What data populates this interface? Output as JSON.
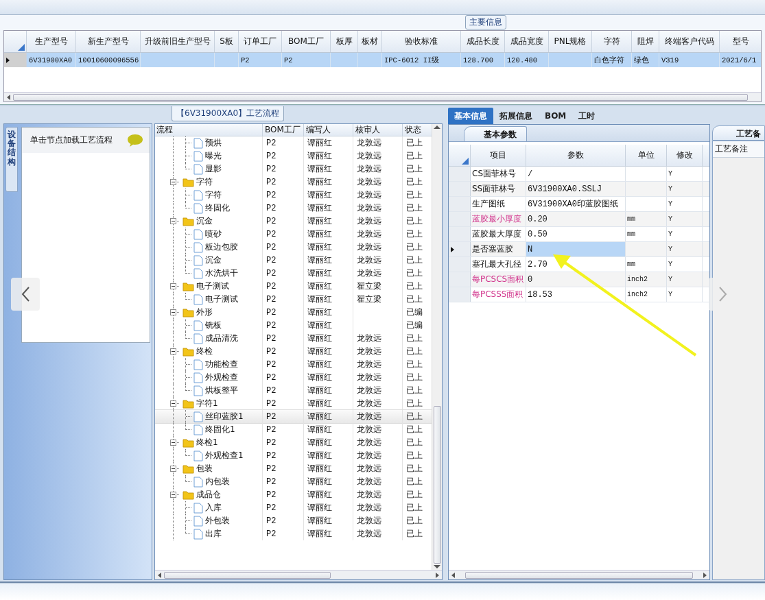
{
  "main_info": {
    "title": "主要信息",
    "columns": [
      "生产型号",
      "新生产型号",
      "升级前旧生产型号",
      "S板",
      "订单工厂",
      "BOM工厂",
      "板厚",
      "板材",
      "验收标准",
      "成品长度",
      "成品宽度",
      "PNL规格",
      "字符",
      "阻焊",
      "终端客户代码",
      "型号"
    ],
    "rows": [
      {
        "selected": true,
        "cells": [
          "6V31900XA0",
          "10010600096556",
          null,
          null,
          "P2",
          "P2",
          null,
          null,
          "IPC-6012 II级",
          "128.700",
          "120.480",
          null,
          "白色字符",
          "绿色",
          "V319",
          "2021/6/1"
        ]
      }
    ]
  },
  "process": {
    "title": "【6V31900XA0】工艺流程",
    "side_tab": "设备结构",
    "hint": "单击节点加载工艺流程",
    "columns": [
      "流程",
      "BOM工厂",
      "编写人",
      "核审人",
      "状态"
    ],
    "tree": [
      {
        "children": [
          {
            "label": "预烘",
            "bom": "P2",
            "writer": "谭丽红",
            "reviewer": "龙敦远",
            "status": "已上",
            "selected": false
          },
          {
            "label": "曝光",
            "bom": "P2",
            "writer": "谭丽红",
            "reviewer": "龙敦远",
            "status": "已上",
            "selected": false
          },
          {
            "label": "显影",
            "bom": "P2",
            "writer": "谭丽红",
            "reviewer": "龙敦远",
            "status": "已上",
            "selected": false
          }
        ]
      },
      {
        "label": "字符",
        "bom": "P2",
        "writer": "谭丽红",
        "reviewer": "龙敦远",
        "status": "已上",
        "selected": false,
        "expanded": true,
        "children": [
          {
            "label": "字符",
            "bom": "P2",
            "writer": "谭丽红",
            "reviewer": "龙敦远",
            "status": "已上",
            "selected": false
          },
          {
            "label": "终固化",
            "bom": "P2",
            "writer": "谭丽红",
            "reviewer": "龙敦远",
            "status": "已上",
            "selected": false
          }
        ]
      },
      {
        "label": "沉金",
        "bom": "P2",
        "writer": "谭丽红",
        "reviewer": "龙敦远",
        "status": "已上",
        "selected": false,
        "expanded": true,
        "children": [
          {
            "label": "喷砂",
            "bom": "P2",
            "writer": "谭丽红",
            "reviewer": "龙敦远",
            "status": "已上",
            "selected": false
          },
          {
            "label": "板边包胶",
            "bom": "P2",
            "writer": "谭丽红",
            "reviewer": "龙敦远",
            "status": "已上",
            "selected": false
          },
          {
            "label": "沉金",
            "bom": "P2",
            "writer": "谭丽红",
            "reviewer": "龙敦远",
            "status": "已上",
            "selected": false
          },
          {
            "label": "水洗烘干",
            "bom": "P2",
            "writer": "谭丽红",
            "reviewer": "龙敦远",
            "status": "已上",
            "selected": false
          }
        ]
      },
      {
        "label": "电子测试",
        "bom": "P2",
        "writer": "谭丽红",
        "reviewer": "翟立梁",
        "status": "已上",
        "selected": false,
        "expanded": true,
        "children": [
          {
            "label": "电子测试",
            "bom": "P2",
            "writer": "谭丽红",
            "reviewer": "翟立梁",
            "status": "已上",
            "selected": false
          }
        ]
      },
      {
        "label": "外形",
        "bom": "P2",
        "writer": "谭丽红",
        "status": "已编",
        "selected": false,
        "expanded": true,
        "children": [
          {
            "label": "铣板",
            "bom": "P2",
            "writer": "谭丽红",
            "status": "已编",
            "selected": false
          },
          {
            "label": "成品清洗",
            "bom": "P2",
            "writer": "谭丽红",
            "reviewer": "龙敦远",
            "status": "已上",
            "selected": false
          }
        ]
      },
      {
        "label": "终检",
        "bom": "P2",
        "writer": "谭丽红",
        "reviewer": "龙敦远",
        "status": "已上",
        "selected": false,
        "expanded": true,
        "children": [
          {
            "label": "功能检查",
            "bom": "P2",
            "writer": "谭丽红",
            "reviewer": "龙敦远",
            "status": "已上",
            "selected": false
          },
          {
            "label": "外观检查",
            "bom": "P2",
            "writer": "谭丽红",
            "reviewer": "龙敦远",
            "status": "已上",
            "selected": false
          },
          {
            "label": "烘板整平",
            "bom": "P2",
            "writer": "谭丽红",
            "reviewer": "龙敦远",
            "status": "已上",
            "selected": false
          }
        ]
      },
      {
        "label": "字符1",
        "bom": "P2",
        "writer": "谭丽红",
        "reviewer": "龙敦远",
        "status": "已上",
        "selected": false,
        "expanded": true,
        "children": [
          {
            "label": "丝印蓝胶1",
            "bom": "P2",
            "writer": "谭丽红",
            "reviewer": "龙敦远",
            "status": "已上",
            "selected": true
          },
          {
            "label": "终固化1",
            "bom": "P2",
            "writer": "谭丽红",
            "reviewer": "龙敦远",
            "status": "已上",
            "selected": false
          }
        ]
      },
      {
        "label": "终检1",
        "bom": "P2",
        "writer": "谭丽红",
        "reviewer": "龙敦远",
        "status": "已上",
        "selected": false,
        "expanded": true,
        "children": [
          {
            "label": "外观检查1",
            "bom": "P2",
            "writer": "谭丽红",
            "reviewer": "龙敦远",
            "status": "已上",
            "selected": false
          }
        ]
      },
      {
        "label": "包装",
        "bom": "P2",
        "writer": "谭丽红",
        "reviewer": "龙敦远",
        "status": "已上",
        "selected": false,
        "expanded": true,
        "children": [
          {
            "label": "内包装",
            "bom": "P2",
            "writer": "谭丽红",
            "reviewer": "龙敦远",
            "status": "已上",
            "selected": false
          }
        ]
      },
      {
        "label": "成品仓",
        "bom": "P2",
        "writer": "谭丽红",
        "reviewer": "龙敦远",
        "status": "已上",
        "selected": false,
        "expanded": true,
        "children": [
          {
            "label": "入库",
            "bom": "P2",
            "writer": "谭丽红",
            "reviewer": "龙敦远",
            "status": "已上",
            "selected": false
          },
          {
            "label": "外包装",
            "bom": "P2",
            "writer": "谭丽红",
            "reviewer": "龙敦远",
            "status": "已上",
            "selected": false
          },
          {
            "label": "出库",
            "bom": "P2",
            "writer": "谭丽红",
            "reviewer": "龙敦远",
            "status": "已上",
            "selected": false
          }
        ]
      }
    ]
  },
  "detail": {
    "tabs": [
      {
        "label": "基本信息",
        "selected": true
      },
      {
        "label": "拓展信息",
        "selected": false
      },
      {
        "label": "BOM",
        "selected": false
      },
      {
        "label": "工时",
        "selected": false
      }
    ],
    "subtab": "基本参数",
    "columns": [
      "项目",
      "参数",
      "单位",
      "修改"
    ],
    "rows": [
      {
        "item": "CS面菲林号",
        "value": "/",
        "modify": "Y",
        "highlighted": false,
        "selected": false
      },
      {
        "item": "SS面菲林号",
        "value": "6V31900XA0.SSLJ",
        "modify": "Y",
        "highlighted": false,
        "selected": false
      },
      {
        "item": "生产图纸",
        "value": "6V31900XA0印蓝胶图纸",
        "modify": "Y",
        "highlighted": false,
        "selected": false
      },
      {
        "item": "蓝胶最小厚度",
        "value": "0.20",
        "unit": "mm",
        "modify": "Y",
        "highlighted": true,
        "selected": false
      },
      {
        "item": "蓝胶最大厚度",
        "value": "0.50",
        "unit": "mm",
        "modify": "Y",
        "highlighted": false,
        "selected": false
      },
      {
        "item": "是否塞蓝胶",
        "value": "N",
        "modify": "Y",
        "highlighted": false,
        "selected": true
      },
      {
        "item": "塞孔最大孔径",
        "value": "2.70",
        "unit": "mm",
        "modify": "Y",
        "highlighted": false,
        "selected": false
      },
      {
        "item": "每PCSCS面积",
        "value": "0",
        "unit": "inch2",
        "modify": "Y",
        "highlighted": true,
        "selected": false
      },
      {
        "item": "每PCSSS面积",
        "value": "18.53",
        "unit": "inch2",
        "modify": "Y",
        "highlighted": true,
        "selected": false
      }
    ]
  },
  "notes": {
    "tab": "工艺备",
    "column": "工艺备注"
  }
}
